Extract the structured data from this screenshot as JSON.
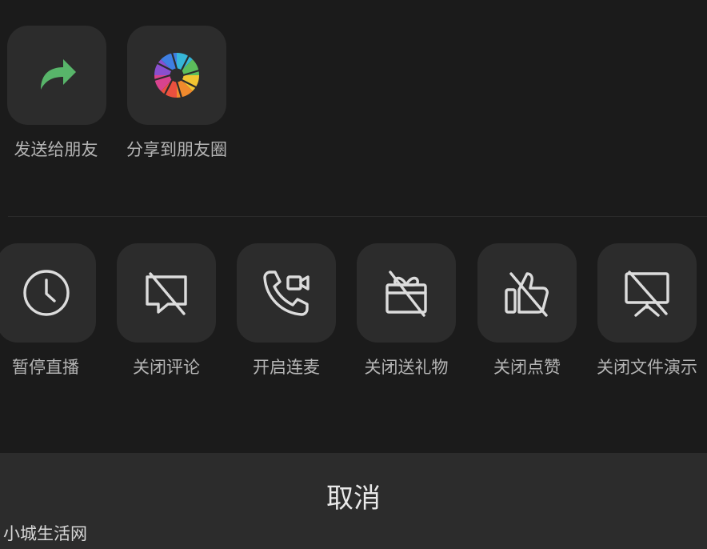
{
  "share_row": [
    {
      "label": "发送给朋友",
      "icon": "share-arrow-icon",
      "accent": "#58b56a"
    },
    {
      "label": "分享到朋友圈",
      "icon": "moments-aperture-icon"
    }
  ],
  "actions_row": [
    {
      "label": "暂停直播",
      "icon": "clock-icon"
    },
    {
      "label": "关闭评论",
      "icon": "comment-off-icon"
    },
    {
      "label": "开启连麦",
      "icon": "phone-video-icon"
    },
    {
      "label": "关闭送礼物",
      "icon": "gift-off-icon"
    },
    {
      "label": "关闭点赞",
      "icon": "like-off-icon"
    },
    {
      "label": "关闭文件演示",
      "icon": "presentation-off-icon"
    }
  ],
  "cancel": {
    "label": "取消"
  },
  "watermark": "小城生活网"
}
